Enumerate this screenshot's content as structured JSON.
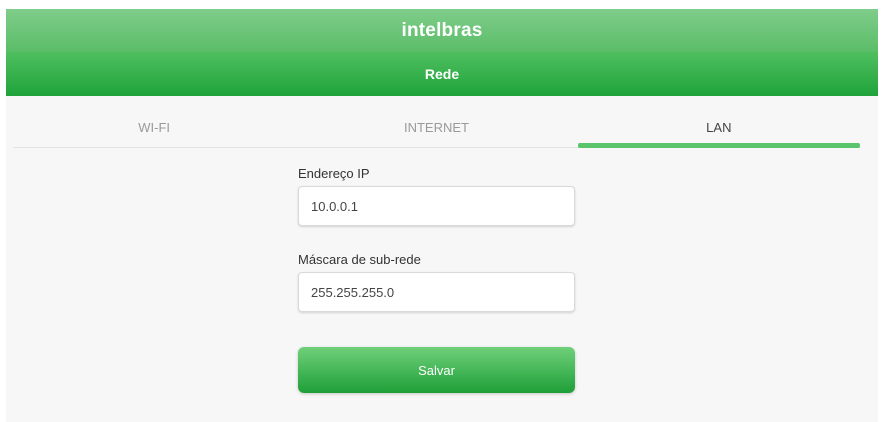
{
  "header": {
    "brand": "intelbras",
    "title": "Rede"
  },
  "tabs": [
    {
      "label": "WI-FI",
      "active": false
    },
    {
      "label": "INTERNET",
      "active": false
    },
    {
      "label": "LAN",
      "active": true
    }
  ],
  "form": {
    "ip": {
      "label": "Endereço IP",
      "value": "10.0.0.1"
    },
    "mask": {
      "label": "Máscara de sub-rede",
      "value": "255.255.255.0"
    },
    "save_label": "Salvar"
  },
  "colors": {
    "brand_green": "#5bbd68",
    "title_green": "#1fa33a",
    "tab_indicator": "#5ac46a"
  }
}
